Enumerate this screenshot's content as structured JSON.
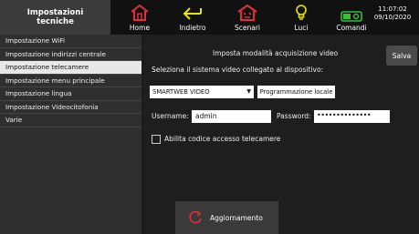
{
  "header": {
    "section_title": "Impostazioni\ntecniche",
    "nav": [
      {
        "label": "Home",
        "icon": "home-icon"
      },
      {
        "label": "Indietro",
        "icon": "back-arrow-icon"
      },
      {
        "label": "Scenari",
        "icon": "scenarios-house-icon"
      },
      {
        "label": "Luci",
        "icon": "lightbulb-icon"
      },
      {
        "label": "Comandi",
        "icon": "toggle-switch-icon"
      }
    ],
    "toggle_text": "ON",
    "time": "11:07:02",
    "date": "09/10/2020"
  },
  "sidebar": {
    "items": [
      {
        "label": "Impostazione WiFi"
      },
      {
        "label": "Impostazione indirizzi centrale"
      },
      {
        "label": "Impostazione telecamere"
      },
      {
        "label": "Impostazione menu principale"
      },
      {
        "label": "Impostazione lingua"
      },
      {
        "label": "Impostazione Videocitofonia"
      },
      {
        "label": "Varie"
      }
    ],
    "active_index": 2
  },
  "main": {
    "heading": "Imposta modalità acquisizione video",
    "save_label": "Salva",
    "select_label": "Seleziona il sistema video collegato al dispositivo:",
    "system_value": "SMARTWEB VIDEO",
    "local_programming_label": "Programmazione locale",
    "username_label": "Username:",
    "username_value": "admin",
    "password_label": "Password:",
    "password_value": "••••••••••••••",
    "access_code_label": "Abilita codice accesso telecamere",
    "access_code_checked": false,
    "update_label": "Aggiornamento"
  },
  "colors": {
    "accent_red": "#e0303a",
    "accent_yellow": "#e8e600",
    "accent_green": "#2fc03a"
  }
}
